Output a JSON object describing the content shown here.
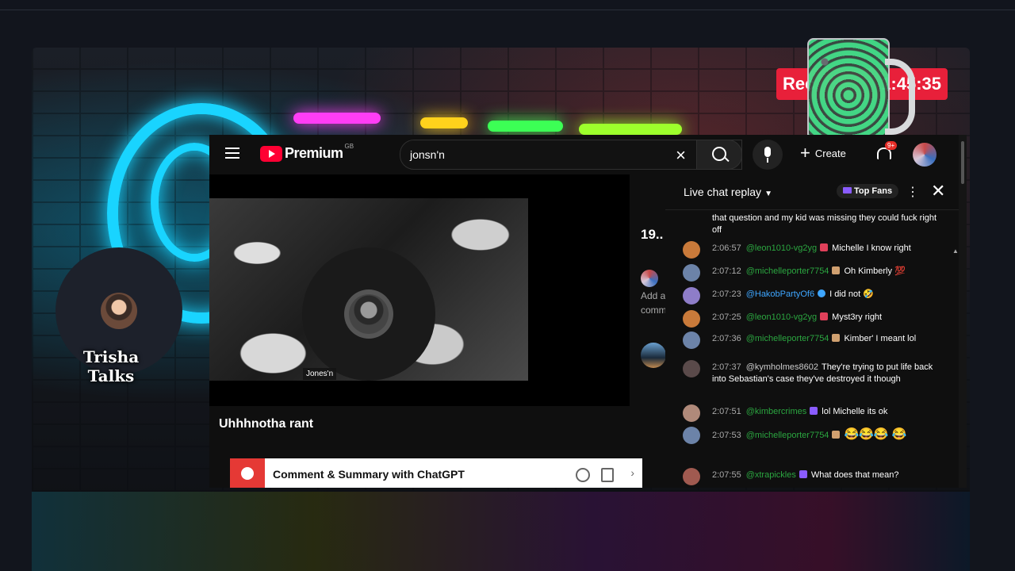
{
  "stream": {
    "rec_label": "Rec",
    "rec_time": "1:45:35",
    "streamer_name": "Trisha Talks"
  },
  "yt": {
    "brand": "Premium",
    "brand_sup": "GB",
    "search_query": "jonsn'n",
    "create_label": "Create",
    "notif_count": "9+",
    "channel_label": "Jones'n",
    "video_title": "Uhhhnotha rant",
    "gpt_label": "Comment & Summary with ChatGPT",
    "side_count": "19..",
    "side_add_lines": [
      "Add a",
      "comm"
    ]
  },
  "chat": {
    "title": "Live chat replay",
    "top_fans": "Top Fans",
    "messages": [
      {
        "time": "",
        "user": "",
        "text": "that question and my kid was missing they could fuck right off"
      },
      {
        "time": "2:06:57",
        "user": "@leon1010-vg2yg",
        "text": "Michelle I know right"
      },
      {
        "time": "2:07:12",
        "user": "@michelleporter7754",
        "text": "Oh Kimberly 💯"
      },
      {
        "time": "2:07:23",
        "user": "@HakobPartyOf6",
        "text": "I did not 🤣"
      },
      {
        "time": "2:07:25",
        "user": "@leon1010-vg2yg",
        "text": "Myst3ry right"
      },
      {
        "time": "2:07:36",
        "user": "@michelleporter7754",
        "text": "Kimber' I meant lol"
      },
      {
        "time": "2:07:37",
        "user": "@kymholmes8602",
        "text": "They're trying to put life back into Sebastian's case they've destroyed it though"
      },
      {
        "time": "2:07:51",
        "user": "@kimbercrimes",
        "text": "lol Michelle its ok"
      },
      {
        "time": "2:07:53",
        "user": "@michelleporter7754",
        "text": "😂😂😂 😂"
      },
      {
        "time": "2:07:55",
        "user": "@xtrapickles",
        "text": "What does that mean?"
      }
    ]
  },
  "icons": [
    "hamburger-icon",
    "youtube-logo-icon",
    "clear-icon",
    "search-icon",
    "mic-icon",
    "plus-icon",
    "bell-icon",
    "chevron-down-icon",
    "kebab-icon",
    "close-icon",
    "chatgpt-icon",
    "copy-icon",
    "chevron-right-icon"
  ]
}
